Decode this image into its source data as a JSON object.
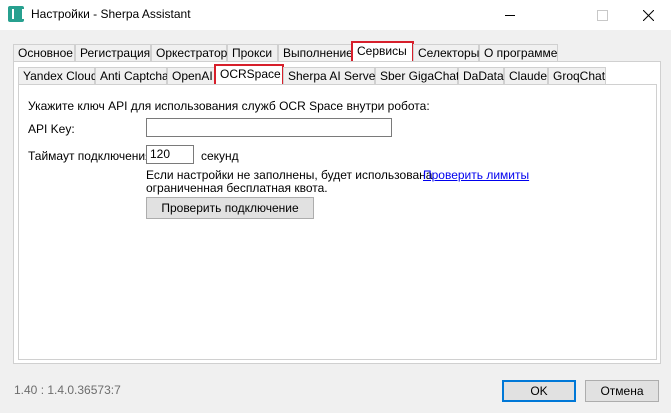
{
  "window": {
    "title": "Настройки - Sherpa Assistant"
  },
  "main_tabs": [
    {
      "label": "Основное"
    },
    {
      "label": "Регистрация"
    },
    {
      "label": "Оркестратор"
    },
    {
      "label": "Прокси"
    },
    {
      "label": "Выполнение"
    },
    {
      "label": "Сервисы"
    },
    {
      "label": "Селекторы"
    },
    {
      "label": "О программе"
    }
  ],
  "main_tabs_active": "Сервисы",
  "sub_tabs": [
    {
      "label": "Yandex Cloud"
    },
    {
      "label": "Anti Captcha"
    },
    {
      "label": "OpenAI"
    },
    {
      "label": "OCRSpace"
    },
    {
      "label": "Sherpa AI Server"
    },
    {
      "label": "Sber GigaChat"
    },
    {
      "label": "DaData"
    },
    {
      "label": "Claude"
    },
    {
      "label": "GroqChat"
    }
  ],
  "sub_tabs_active": "OCRSpace",
  "content": {
    "instruction": "Укажите ключ API для использования служб OCR Space внутри робота:",
    "api_key_label": "API Key:",
    "api_key_value": "",
    "timeout_label": "Таймаут подключения:",
    "timeout_value": "120",
    "timeout_unit": "секунд",
    "note_line1": "Если настройки не заполнены, будет использована",
    "note_line2": "ограниченная бесплатная квота.",
    "check_limits_link": "Проверить лимиты",
    "check_connection_button": "Проверить подключение"
  },
  "footer": {
    "version": "1.40 : 1.4.0.36573:7",
    "ok_button": "OK",
    "cancel_button": "Отмена"
  },
  "colors": {
    "highlight": "#d71f2b",
    "link": "#0000ee",
    "app_icon": "#27a08f",
    "primary_button_border": "#0078d7"
  }
}
